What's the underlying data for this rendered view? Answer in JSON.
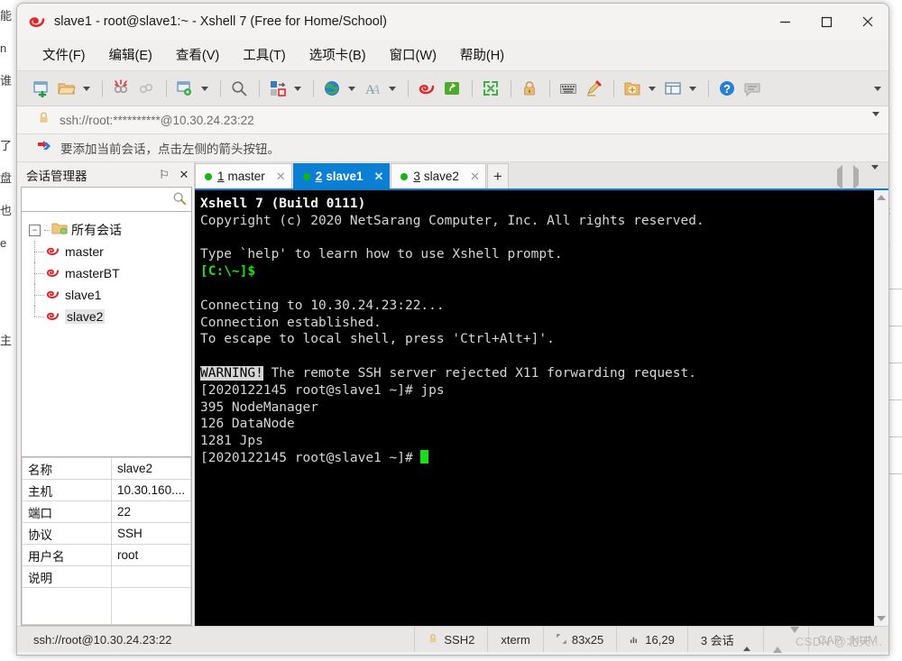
{
  "window": {
    "title": "slave1 - root@slave1:~ - Xshell 7 (Free for Home/School)",
    "app_icon": "xshell-spiral-icon",
    "minimize_label": "—",
    "maximize_label": "□",
    "close_label": "✕"
  },
  "menubar": {
    "items": [
      {
        "label": "文件(F)",
        "name": "menu-file"
      },
      {
        "label": "编辑(E)",
        "name": "menu-edit"
      },
      {
        "label": "查看(V)",
        "name": "menu-view"
      },
      {
        "label": "工具(T)",
        "name": "menu-tools"
      },
      {
        "label": "选项卡(B)",
        "name": "menu-tabs"
      },
      {
        "label": "窗口(W)",
        "name": "menu-window"
      },
      {
        "label": "帮助(H)",
        "name": "menu-help"
      }
    ]
  },
  "toolbar": {
    "buttons": [
      "new-session-icon",
      "open-folder-icon",
      "disconnect-icon",
      "reconnect-icon",
      "session-properties-icon",
      "find-icon",
      "transfer-icon",
      "globe-icon",
      "font-icon",
      "xshell-icon",
      "xftp-icon",
      "fullscreen-icon",
      "lock-icon",
      "keyboard-icon",
      "highlight-icon",
      "add-folder-icon",
      "layout-icon",
      "help-icon",
      "comment-icon"
    ],
    "overflow_label": "▾"
  },
  "addressbar": {
    "icon": "lock-icon",
    "value": "ssh://root:**********@10.30.24.23:22",
    "placeholder": "ssh://root:**********@10.30.24.23:22",
    "dropdown_label": "▾"
  },
  "notice": {
    "icon": "red-blue-arrow-icon",
    "text": "要添加当前会话，点击左侧的箭头按钮。"
  },
  "session_manager": {
    "title": "会话管理器",
    "pin_label": "⚐",
    "close_label": "✕",
    "search_value": "",
    "search_placeholder": "",
    "search_icon": "magnifier-icon",
    "tree": {
      "root_label": "所有会话",
      "root_icon": "folder-icon",
      "expanded": true,
      "children": [
        {
          "label": "master",
          "icon": "session-icon",
          "selected": false
        },
        {
          "label": "masterBT",
          "icon": "session-icon",
          "selected": false
        },
        {
          "label": "slave1",
          "icon": "session-icon",
          "selected": false
        },
        {
          "label": "slave2",
          "icon": "session-icon",
          "selected": true
        }
      ]
    },
    "properties": [
      {
        "key": "名称",
        "value": "slave2"
      },
      {
        "key": "主机",
        "value": "10.30.160...."
      },
      {
        "key": "端口",
        "value": "22"
      },
      {
        "key": "协议",
        "value": "SSH"
      },
      {
        "key": "用户名",
        "value": "root"
      },
      {
        "key": "说明",
        "value": ""
      },
      {
        "key": "",
        "value": ""
      }
    ]
  },
  "tabs": {
    "items": [
      {
        "num": "1",
        "label": "master",
        "active": false,
        "close_label": "✕",
        "status": "connected"
      },
      {
        "num": "2",
        "label": "slave1",
        "active": true,
        "close_label": "✕",
        "status": "connected"
      },
      {
        "num": "3",
        "label": "slave2",
        "active": false,
        "close_label": "✕",
        "status": "connected"
      }
    ],
    "add_label": "+",
    "scroll_left": "◀",
    "scroll_right": "▶",
    "menu_label": "▾"
  },
  "terminal": {
    "lines": [
      {
        "segs": [
          {
            "t": "Xshell 7 (Build 0111)",
            "c": "bold"
          }
        ]
      },
      {
        "segs": [
          {
            "t": "Copyright (c) 2020 NetSarang Computer, Inc. All rights reserved.",
            "c": ""
          }
        ]
      },
      {
        "segs": [
          {
            "t": "",
            "c": ""
          }
        ]
      },
      {
        "segs": [
          {
            "t": "Type `help' to learn how to use Xshell prompt.",
            "c": ""
          }
        ]
      },
      {
        "segs": [
          {
            "t": "[C:\\~]$",
            "c": "green"
          }
        ]
      },
      {
        "segs": [
          {
            "t": "",
            "c": ""
          }
        ]
      },
      {
        "segs": [
          {
            "t": "Connecting to 10.30.24.23:22...",
            "c": ""
          }
        ]
      },
      {
        "segs": [
          {
            "t": "Connection established.",
            "c": ""
          }
        ]
      },
      {
        "segs": [
          {
            "t": "To escape to local shell, press 'Ctrl+Alt+]'.",
            "c": ""
          }
        ]
      },
      {
        "segs": [
          {
            "t": "",
            "c": ""
          }
        ]
      },
      {
        "segs": [
          {
            "t": "WARNING!",
            "c": "inv"
          },
          {
            "t": " The remote SSH server rejected X11 forwarding request.",
            "c": ""
          }
        ]
      },
      {
        "segs": [
          {
            "t": "[2020122145 root@slave1 ~]# jps",
            "c": ""
          }
        ]
      },
      {
        "segs": [
          {
            "t": "395 NodeManager",
            "c": ""
          }
        ]
      },
      {
        "segs": [
          {
            "t": "126 DataNode",
            "c": ""
          }
        ]
      },
      {
        "segs": [
          {
            "t": "1281 Jps",
            "c": ""
          }
        ]
      },
      {
        "segs": [
          {
            "t": "[2020122145 root@slave1 ~]# ",
            "c": ""
          },
          {
            "t": "",
            "c": "cursor"
          }
        ]
      }
    ]
  },
  "statusbar": {
    "connection": "ssh://root@10.30.24.23:22",
    "security_icon": "lock-icon",
    "protocol": "SSH2",
    "term_type": "xterm",
    "size_icon": "resize-icon",
    "size": "83x25",
    "cursor_icon": "cursor-icon",
    "cursor_pos": "16,29",
    "sessions": "3 会话",
    "sessions_caret": "▴",
    "xfer_up": "▲",
    "xfer_down": "▼",
    "caps": "CAP",
    "num": "NUM",
    "watermark": "CSDN @北天…"
  },
  "colors": {
    "accent": "#0b7fd4",
    "terminal_bg": "#000000",
    "terminal_fg": "#d6d6d6",
    "prompt_green": "#18e018",
    "window_chrome": "#f1f0ee"
  }
}
